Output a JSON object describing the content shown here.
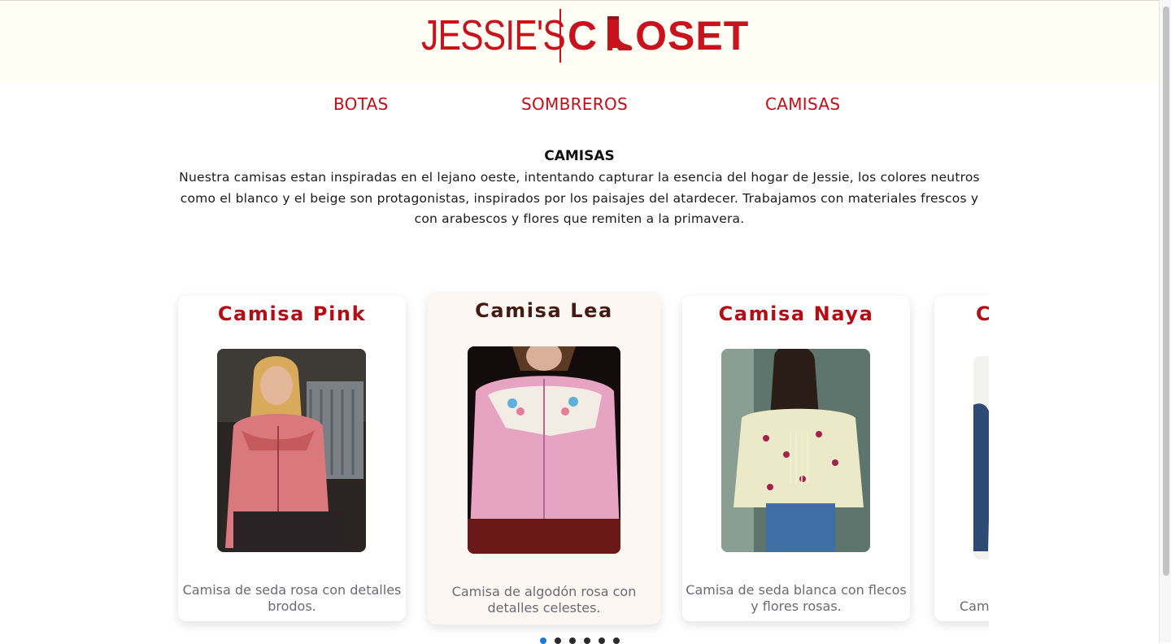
{
  "brand": {
    "left": "JESSIE'S",
    "right_a": "C",
    "right_b": "OSET"
  },
  "nav": [
    {
      "label": "BOTAS"
    },
    {
      "label": "SOMBREROS"
    },
    {
      "label": "CAMISAS"
    }
  ],
  "section": {
    "title": "CAMISAS",
    "description": "Nuestra camisas estan inspiradas en el lejano oeste, intentando capturar la esencia del hogar de Jessie, los colores neutros como el blanco y el beige son protagonistas, inspirados por los paisajes del atardecer. Trabajamos con materiales frescos y con arabescos y flores que remiten a la primavera."
  },
  "cards": [
    {
      "title": "Camisa Pink",
      "desc": "Camisa de seda rosa con detalles brodos."
    },
    {
      "title": "Camisa Lea",
      "desc": "Camisa de algodón rosa con detalles celestes."
    },
    {
      "title": "Camisa Naya",
      "desc": "Camisa de seda blanca con flecos y flores rosas."
    },
    {
      "title": "C",
      "desc": "Cami"
    }
  ],
  "colors": {
    "brand_red": "#c20d17",
    "active_card": "#fcf7f2",
    "dot_active": "#1e7ad6"
  },
  "carousel": {
    "dots": 6,
    "active_dot": 1
  }
}
